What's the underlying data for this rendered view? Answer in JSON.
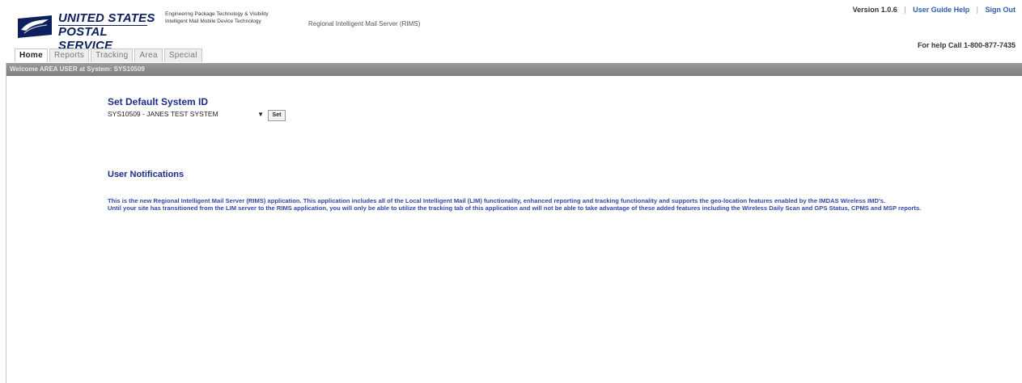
{
  "header": {
    "brand_line1": "UNITED STATES",
    "brand_line2": "POSTAL SERVICE",
    "sub_line1": "Engineering Package Technology & Visibility",
    "sub_line2": "Intelligent Mail Mobile Device Technology",
    "app_name": "Regional Intelligent Mail Server (RIMS)",
    "version": "Version 1.0.6",
    "user_guide_help": "User Guide Help",
    "sign_out": "Sign Out",
    "help_line": "For help Call 1-800-877-7435"
  },
  "tabs": [
    {
      "label": "Home",
      "active": true
    },
    {
      "label": "Reports",
      "active": false
    },
    {
      "label": "Tracking",
      "active": false
    },
    {
      "label": "Area",
      "active": false
    },
    {
      "label": "Special",
      "active": false
    }
  ],
  "welcome_text": "Welcome AREA USER at System: SYS10509",
  "default_system": {
    "title": "Set Default System ID",
    "selected": "SYS10509 - JANES TEST SYSTEM",
    "set_label": "Set"
  },
  "notifications": {
    "title": "User Notifications",
    "paragraph1": "This is the new Regional Intelligent Mail Server (RIMS) application. This application includes all of the Local Intelligent Mail (LIM) functionality, enhanced reporting and tracking functionality and supports the geo-location features enabled by the IMDAS Wireless IMD's.",
    "paragraph2": "Until your site has transitioned from the LIM server to the RIMS application, you will only be able to utilize the tracking tab of this application and will not be able to take advantage of these added features including the Wireless Daily Scan and GPS Status, CPMS and MSP reports."
  },
  "colors": {
    "brand_blue": "#0d1f5c",
    "heading_blue": "#1a2c8a",
    "link_blue": "#2b5fb0",
    "banner_gray": "#8a8a8a"
  }
}
